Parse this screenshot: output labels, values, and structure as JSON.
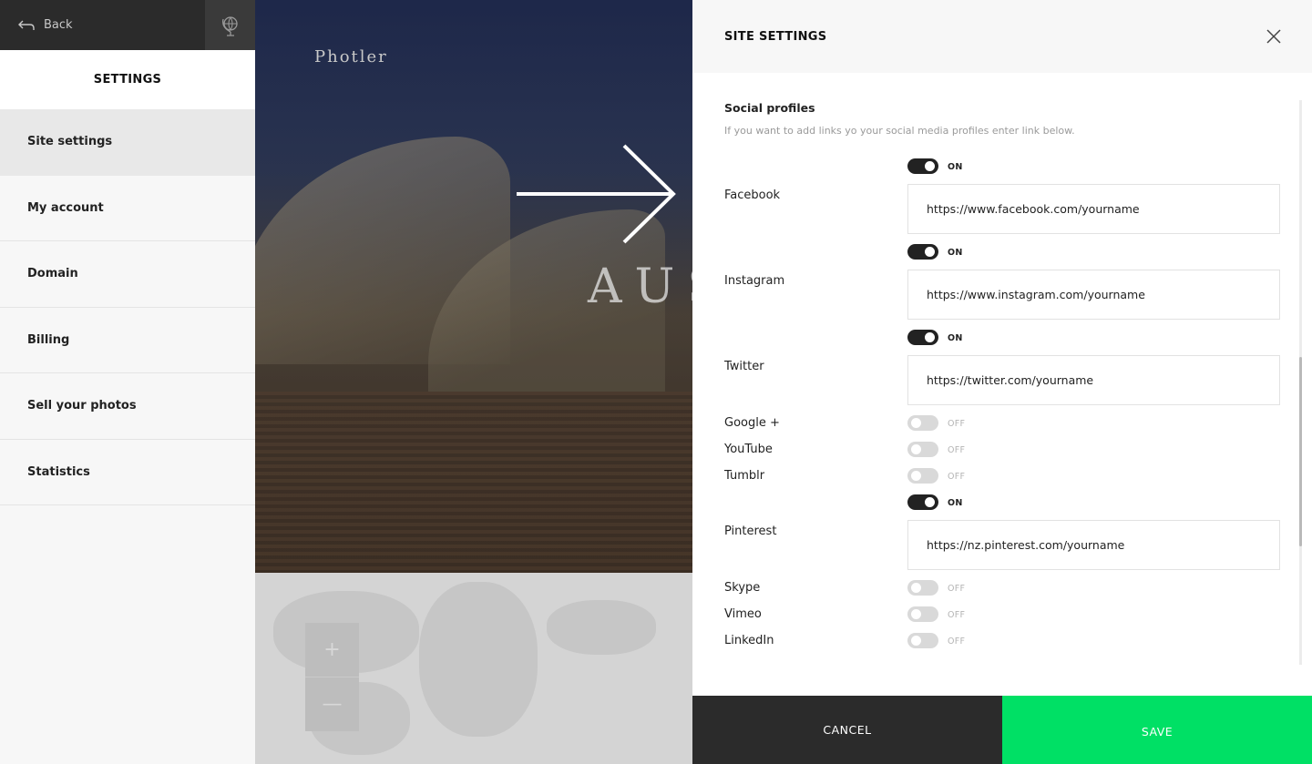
{
  "sidebar": {
    "back_label": "Back",
    "back_icon": "arrow-left-icon",
    "globe_icon": "globe-icon",
    "title": "SETTINGS",
    "items": [
      {
        "label": "Site settings",
        "active": true
      },
      {
        "label": "My account"
      },
      {
        "label": "Domain"
      },
      {
        "label": "Billing"
      },
      {
        "label": "Sell your photos"
      },
      {
        "label": "Statistics"
      }
    ]
  },
  "preview": {
    "brand": "Photler",
    "hero_text": "AUS",
    "zoom_in": "+",
    "zoom_out": "—"
  },
  "panel": {
    "title": "SITE SETTINGS",
    "close_icon": "close-icon",
    "section_title": "Social profiles",
    "section_desc": "If you want to add links yo your social media profiles enter link below.",
    "profiles": [
      {
        "name": "Facebook",
        "state": "ON",
        "url": "https://www.facebook.com/yourname"
      },
      {
        "name": "Instagram",
        "state": "ON",
        "url": "https://www.instagram.com/yourname"
      },
      {
        "name": "Twitter",
        "state": "ON",
        "url": "https://twitter.com/yourname"
      },
      {
        "name": "Google +",
        "state": "OFF"
      },
      {
        "name": "YouTube",
        "state": "OFF"
      },
      {
        "name": "Tumblr",
        "state": "OFF"
      },
      {
        "name": "Pinterest",
        "state": "ON",
        "url": "https://nz.pinterest.com/yourname"
      },
      {
        "name": "Skype",
        "state": "OFF"
      },
      {
        "name": "Vimeo",
        "state": "OFF"
      },
      {
        "name": "LinkedIn",
        "state": "OFF"
      }
    ]
  },
  "footer": {
    "cancel_label": "CANCEL",
    "save_label": "SAVE"
  },
  "colors": {
    "save_green": "#00e065",
    "dark": "#2b2b2b"
  }
}
